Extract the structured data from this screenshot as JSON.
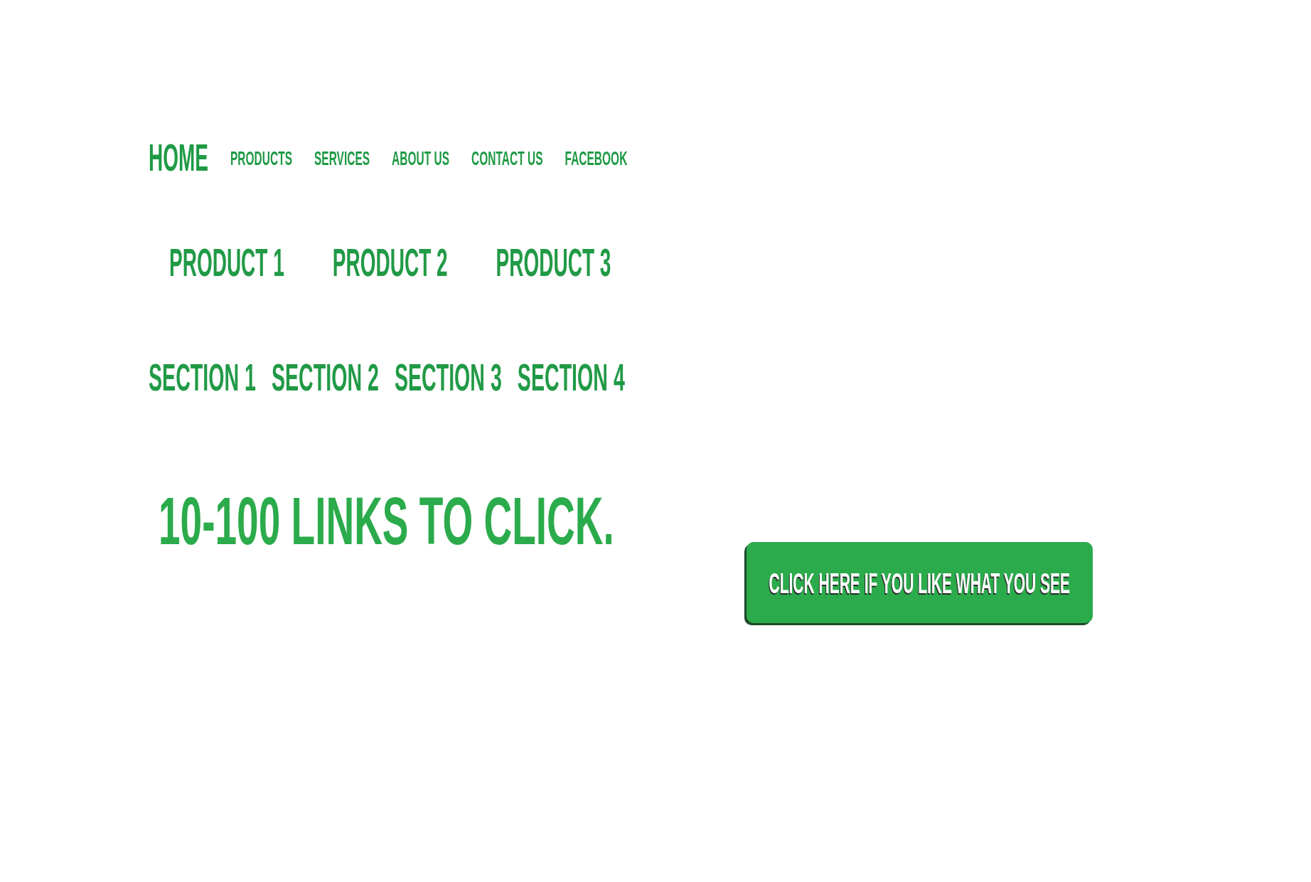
{
  "nav": {
    "items": [
      {
        "label": "HOME",
        "selected": true
      },
      {
        "label": "PRODUCTS",
        "selected": false
      },
      {
        "label": "SERVICES",
        "selected": false
      },
      {
        "label": "ABOUT US",
        "selected": false
      },
      {
        "label": "CONTACT US",
        "selected": false
      },
      {
        "label": "FACEBOOK",
        "selected": false
      }
    ]
  },
  "products": [
    "PRODUCT 1",
    "PRODUCT 2",
    "PRODUCT 3"
  ],
  "sections": [
    "SECTION 1",
    "SECTION 2",
    "SECTION 3",
    "SECTION 4"
  ],
  "headline": "10-100 LINKS TO CLICK.",
  "cta_button": {
    "label": "CLICK HERE IF YOU LIKE WHAT YOU SEE"
  }
}
